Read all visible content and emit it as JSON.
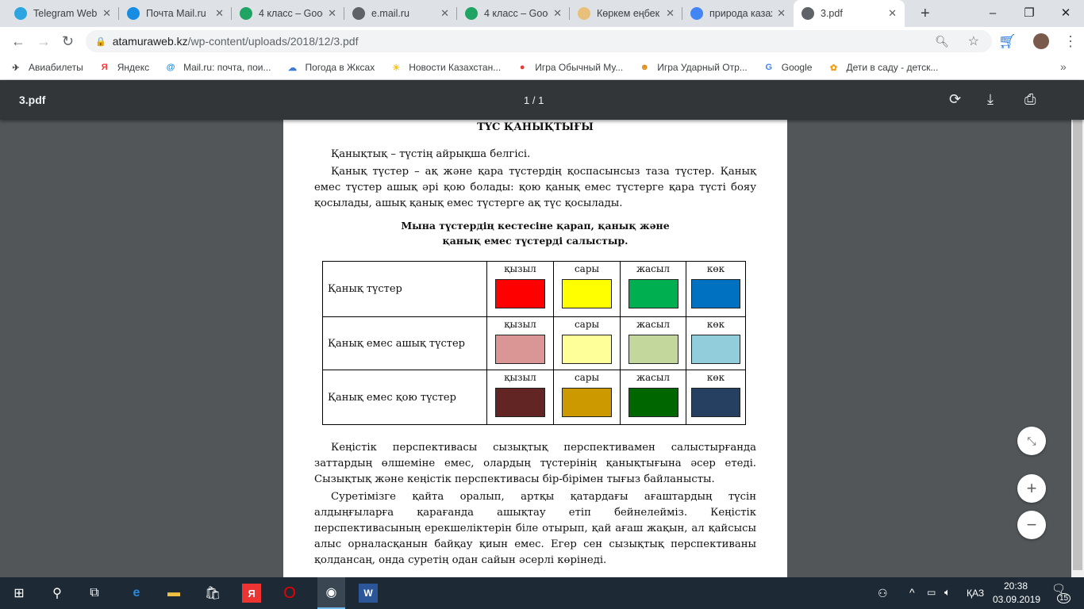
{
  "tabs": [
    {
      "title": "Telegram Web",
      "icon": "telegram-icon",
      "color": "#2ca5e0"
    },
    {
      "title": "Почта Mail.ru",
      "icon": "mailru-icon",
      "color": "#168de2"
    },
    {
      "title": "4 класс – Goog",
      "icon": "google-drive-icon",
      "color": "#1fa463"
    },
    {
      "title": "e.mail.ru",
      "icon": "globe-icon",
      "color": "#5f6368"
    },
    {
      "title": "4 класс – Goog",
      "icon": "google-drive-icon",
      "color": "#1fa463"
    },
    {
      "title": "Көркем еңбек",
      "icon": "ornament-icon",
      "color": "#e8c07a"
    },
    {
      "title": "природа казах",
      "icon": "google-icon",
      "color": "#4285f4"
    },
    {
      "title": "3.pdf",
      "icon": "globe-icon",
      "color": "#5f6368"
    }
  ],
  "address": {
    "host": "atamuraweb.kz",
    "path": "/wp-content/uploads/2018/12/3.pdf"
  },
  "bookmarks": [
    {
      "label": "Авиабилеты",
      "glyph": "✈",
      "color": "#444"
    },
    {
      "label": "Яндекс",
      "glyph": "Я",
      "color": "#f33"
    },
    {
      "label": "Mail.ru: почта, пои...",
      "glyph": "@",
      "color": "#168de2"
    },
    {
      "label": "Погода в Жксах",
      "glyph": "☁",
      "color": "#3a7bd5"
    },
    {
      "label": "Новости Казахстан...",
      "glyph": "☀",
      "color": "#f5c518"
    },
    {
      "label": "Игра Обычный Му...",
      "glyph": "●",
      "color": "#e53935"
    },
    {
      "label": "Игра Ударный Отр...",
      "glyph": "☻",
      "color": "#d98b1a"
    },
    {
      "label": "Google",
      "glyph": "G",
      "color": "#4285f4"
    },
    {
      "label": "Дети в саду - детск...",
      "glyph": "✿",
      "color": "#f39c12"
    }
  ],
  "pdf": {
    "name": "3.pdf",
    "pages": "1 / 1"
  },
  "doc": {
    "title": "ТҮС ҚАНЫҚТЫҒЫ",
    "p1": "Қанықтық – түстің айрықша белгісі.",
    "p2": "Қанық түстер – ақ және қара түстердің қоспасынсыз таза түстер. Қанық емес түстер ашық әрі қою болады:  қою қанық емес түстерге қара түсті бояу қосылады, ашық қанық емес түстерге ақ түс қосылады.",
    "instr1": "Мына түстердің кестесіне қарап, қанық және",
    "instr2": "қанық емес түстерді салыстыр.",
    "rows": [
      {
        "label": "Қанық түстер",
        "cells": [
          {
            "name": "қызыл",
            "color": "#ff0000"
          },
          {
            "name": "сары",
            "color": "#ffff00"
          },
          {
            "name": "жасыл",
            "color": "#00b050"
          },
          {
            "name": "көк",
            "color": "#0070c0"
          }
        ]
      },
      {
        "label": "Қанық емес ашық түстер",
        "cells": [
          {
            "name": "қызыл",
            "color": "#d99694"
          },
          {
            "name": "сары",
            "color": "#ffff99"
          },
          {
            "name": "жасыл",
            "color": "#c3d69b"
          },
          {
            "name": "көк",
            "color": "#92cddc"
          }
        ]
      },
      {
        "label": "Қанық емес қою түстер",
        "cells": [
          {
            "name": "қызыл",
            "color": "#632523"
          },
          {
            "name": "сары",
            "color": "#cc9900"
          },
          {
            "name": "жасыл",
            "color": "#006600"
          },
          {
            "name": "көк",
            "color": "#254061"
          }
        ]
      }
    ],
    "p3": "Кеңістік перспективасы сызықтық перспективамен салыстырғанда заттардың өлшеміне емес, олардың түстерінің қанықтығына әсер етеді. Сызықтық және кеңістік перспективасы бір-бірімен тығыз байланысты.",
    "p4": "Суретімізге қайта оралып, артқы қатардағы ағаштардың түсін алдыңғыларға қарағанда ашықтау етіп бейнелейміз. Кеңістік перспективасының ерекшеліктерін біле отырып, қай ағаш жақын, ал қайсысы алыс орналасқанын байқау қиын емес. Егер сен сызықтық перспективаны қолдансаң, онда суретің одан сайын әсерлі көрінеді."
  },
  "tray": {
    "lang": "ҚАЗ",
    "time": "20:38",
    "date": "03.09.2019",
    "notifications": "15"
  }
}
